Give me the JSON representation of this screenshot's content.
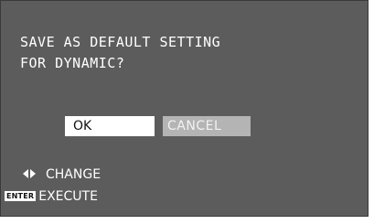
{
  "dialog": {
    "prompt_line1": "SAVE AS DEFAULT SETTING",
    "prompt_line2": "FOR DYNAMIC?"
  },
  "buttons": {
    "ok_label": "OK",
    "cancel_label": "CANCEL",
    "selected": "OK"
  },
  "hints": {
    "change_icon": "left-right-arrow-icon",
    "change_label": "CHANGE",
    "execute_icon": "enter-key-icon",
    "execute_key": "ENTER",
    "execute_label": "EXECUTE"
  },
  "colors": {
    "background": "#5c5c5c",
    "text": "#ffffff",
    "selected_button": "#ffffff",
    "unselected_button": "#b4b4b4"
  }
}
